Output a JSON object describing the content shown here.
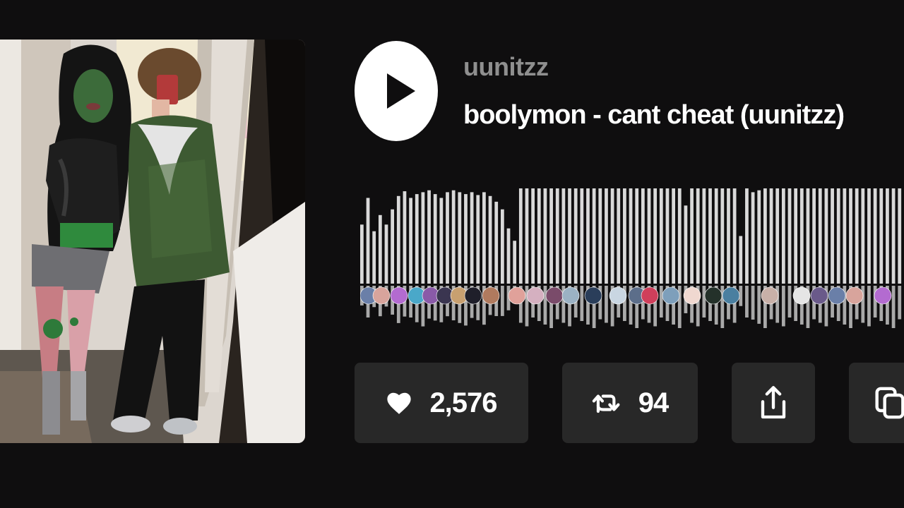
{
  "track": {
    "artist": "uunitzz",
    "title": "boolymon - cant cheat (uunitzz)"
  },
  "player": {
    "play_icon": "play-icon",
    "waveform_levels": [
      0.62,
      0.9,
      0.55,
      0.72,
      0.62,
      0.78,
      0.92,
      0.97,
      0.9,
      0.94,
      0.96,
      0.98,
      0.94,
      0.9,
      0.96,
      0.98,
      0.96,
      0.94,
      0.96,
      0.93,
      0.96,
      0.92,
      0.86,
      0.78,
      0.58,
      0.45,
      1.0,
      1.0,
      1.0,
      1.0,
      1.0,
      1.0,
      1.0,
      1.0,
      1.0,
      1.0,
      1.0,
      1.0,
      1.0,
      1.0,
      1.0,
      1.0,
      1.0,
      1.0,
      1.0,
      1.0,
      1.0,
      1.0,
      1.0,
      1.0,
      1.0,
      1.0,
      1.0,
      0.82,
      1.0,
      1.0,
      1.0,
      1.0,
      1.0,
      1.0,
      1.0,
      1.0,
      0.5,
      1.0,
      0.96,
      0.98,
      1.0,
      1.0,
      1.0,
      1.0,
      1.0,
      1.0,
      1.0,
      1.0,
      1.0,
      1.0,
      1.0,
      1.0,
      1.0,
      1.0,
      1.0,
      1.0,
      1.0,
      1.0,
      1.0,
      1.0,
      1.0,
      1.0,
      1.0
    ],
    "waveform_color": "#d9d9d9",
    "comment_avatar_colors": [
      "#6a7fa8",
      "#d8a49c",
      "#b36bd0",
      "#4aa8c9",
      "#8a5aa8",
      "#3a3550",
      "#c8a070",
      "#1f1f2a",
      "#b07a5e",
      "#e0a19a",
      "#d5b0c0",
      "#7a4b6a",
      "#9bb2c4",
      "#2a3e5a",
      "#c9d6e2",
      "#5c6e8a",
      "#cf3f5b",
      "#7e9fbb",
      "#f0d8d0",
      "#24312a",
      "#4a7fa0",
      "#c8b0a8",
      "#e5e5e5",
      "#6a5a8a"
    ]
  },
  "actions": {
    "like_count": "2,576",
    "repost_count": "94",
    "like_icon": "heart-icon",
    "repost_icon": "repost-icon",
    "share_icon": "share-icon",
    "copy_icon": "copy-icon"
  },
  "colors": {
    "background": "#0f0e0f",
    "button_bg": "#282828",
    "text_primary": "#ffffff",
    "text_secondary": "#8f8f8f"
  }
}
